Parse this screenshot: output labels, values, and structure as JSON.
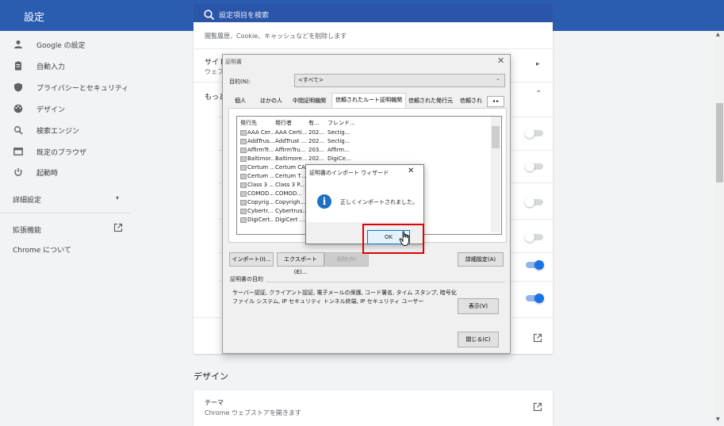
{
  "app_title": "設定",
  "search": {
    "placeholder": "設定項目を検索"
  },
  "sidebar": {
    "items": [
      {
        "label": "Google の設定",
        "icon": "person-icon"
      },
      {
        "label": "自動入力",
        "icon": "clipboard-icon"
      },
      {
        "label": "プライバシーとセキュリティ",
        "icon": "shield-icon"
      },
      {
        "label": "デザイン",
        "icon": "palette-icon"
      },
      {
        "label": "検索エンジン",
        "icon": "search-icon"
      },
      {
        "label": "既定のブラウザ",
        "icon": "browser-icon"
      },
      {
        "label": "起動時",
        "icon": "power-icon"
      }
    ],
    "advanced": "詳細設定",
    "extensions": "拡張機能",
    "about": "Chrome について"
  },
  "main": {
    "clear_data_subtitle": "閲覧履歴、Cookie、キャッシュなどを削除します",
    "site_settings_title_partial": "サイト",
    "site_settings_sub_partial": "ウェブ",
    "more_partial": "もっと",
    "toggles": [
      false,
      false,
      false,
      false,
      true,
      true
    ],
    "design_section": "デザイン",
    "theme_title": "テーマ",
    "theme_subtitle": "Chrome ウェブストアを開きます"
  },
  "cert_dialog": {
    "title": "証明書",
    "purpose_label": "目的(N):",
    "purpose_value": "<すべて>",
    "tabs": [
      "個人",
      "ほかの人",
      "中間証明機関",
      "信頼されたルート証明機関",
      "信頼された発行元",
      "信頼され"
    ],
    "columns": [
      "発行先",
      "発行者",
      "有...",
      "フレンド..."
    ],
    "rows": [
      [
        "AAA Cer...",
        "AAA Certi...",
        "202...",
        "Sectig..."
      ],
      [
        "AddTrus...",
        "AddTrust ...",
        "202...",
        "Sectig..."
      ],
      [
        "AffirmTr...",
        "AffirmTru...",
        "203...",
        "Affirm..."
      ],
      [
        "Baltimor...",
        "Baltimore...",
        "202...",
        "DigiCe..."
      ],
      [
        "Certum ...",
        "Certum CA",
        "",
        ""
      ],
      [
        "Certum ...",
        "Certum T...",
        "",
        ""
      ],
      [
        "Class 3 ...",
        "Class 3 P...",
        "",
        ""
      ],
      [
        "COMOD...",
        "COMOD...",
        "",
        ""
      ],
      [
        "Copyrig...",
        "Copyrigh...",
        "",
        ""
      ],
      [
        "Cybertr...",
        "Cybertrus...",
        "",
        ""
      ],
      [
        "DigiCert...",
        "DigiCert ...",
        "",
        ""
      ]
    ],
    "import_button": "インポート(I)...",
    "export_button": "エクスポート(E)...",
    "delete_button": "削除(R)",
    "advanced_button": "詳細設定(A)",
    "purpose_group_label": "証明書の目的",
    "purpose_text": "サーバー認証, クライアント認証, 電子メールの保護, コード署名, タイム スタンプ, 暗号化ファイル システム, IP セキュリティ トンネル終端, IP セキュリティ ユーザー",
    "view_button": "表示(V)",
    "close_button": "閉じる(C)"
  },
  "wizard": {
    "title": "証明書のインポート ウィザード",
    "message": "正しくインポートされました。",
    "ok_button": "OK"
  },
  "colors": {
    "topbar": "#2a5db0",
    "toggle_on": "#1a73e8",
    "highlight": "#e00000"
  }
}
